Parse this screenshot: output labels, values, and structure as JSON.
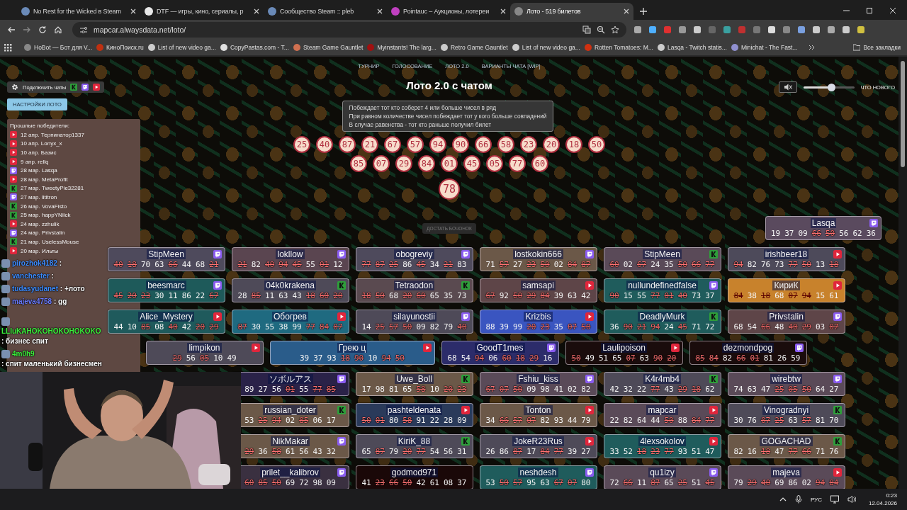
{
  "browser": {
    "tabs": [
      {
        "title": "No Rest for the Wicked в Steam",
        "selected": false
      },
      {
        "title": "DTF — игры, кино, сериалы, р",
        "selected": false
      },
      {
        "title": "Сообщество Steam :: pleb",
        "selected": false
      },
      {
        "title": "Pointauc – Аукционы, лотереи",
        "selected": false
      },
      {
        "title": "Лото - 519 билетов",
        "selected": true
      }
    ],
    "address": "mapcar.alwaysdata.net/loto/",
    "bookmarks": [
      "HoBot — Бот для V...",
      "КиноПоиск.ru",
      "List of new video ga...",
      "CopyPastas.com - T...",
      "Steam Game Gauntlet",
      "Myinstants! The larg...",
      "Retro Game Gauntlet",
      "List of new video ga...",
      "Rotten Tomatoes: M...",
      "Lasqa - Twitch statis...",
      "Minichat - The Fast..."
    ],
    "all_bookmarks": "Все закладки"
  },
  "page": {
    "nav": [
      "ТУРНИР",
      "ГОЛОСОВАНИЕ",
      "ЛОТО 2.0",
      "ВАРИАНТЫ ЧАТА [WIP]"
    ],
    "title": "Лото 2.0 с чатом",
    "rules": [
      "Побеждает тот кто соберет 4 или больше чисел в ряд",
      "При равном количестве чисел побеждает тот у кого больше совпадений",
      "В случае равенства - тот кто раньше получил билет"
    ],
    "connect_chats": "Подключить чаты",
    "settings_button": "НАСТРОЙКИ ЛОТО",
    "sound": {
      "muted": true
    },
    "volume": {
      "level": 0.55
    },
    "whats_new": "ЧТО НОВОГО",
    "drawn_numbers": [
      [
        "25",
        "40",
        "87",
        "21",
        "67",
        "57",
        "94",
        "90",
        "66",
        "58",
        "23",
        "20",
        "18",
        "50"
      ],
      [
        "85",
        "07",
        "29",
        "84",
        "01",
        "45",
        "05",
        "77",
        "60"
      ]
    ],
    "last_number": "78",
    "draw_button": {
      "label": "ДОСТАТЬ БОЧОНОК",
      "disabled": true
    },
    "winners": {
      "title": "Прошлые победители:",
      "items": [
        {
          "text": "12 апр. Терпинатор1337",
          "kind": "youtube"
        },
        {
          "text": "10 апр. Lonyx_x",
          "kind": "youtube"
        },
        {
          "text": "10 апр. Базис",
          "kind": "youtube"
        },
        {
          "text": "9 апр. rellq",
          "kind": "youtube"
        },
        {
          "text": "28 мар. Lasqa",
          "kind": "twitch"
        },
        {
          "text": "28 мар. MetaProfit",
          "kind": "youtube"
        },
        {
          "text": "27 мар. TweetyPie32281",
          "kind": "kick"
        },
        {
          "text": "27 мар. lititron",
          "kind": "twitch"
        },
        {
          "text": "26 мар. VovaFisto",
          "kind": "kick"
        },
        {
          "text": "25 мар. happYNiick",
          "kind": "kick"
        },
        {
          "text": "24 мар. zzhulik",
          "kind": "youtube"
        },
        {
          "text": "24 мар. Privstalin",
          "kind": "twitch"
        },
        {
          "text": "21 мар. UselessMouse",
          "kind": "kick"
        },
        {
          "text": "20 мар. Ильты",
          "kind": "youtube"
        }
      ]
    },
    "ticket_rows": [
      [
        {
          "name": "Lasqa",
          "kind": "twitch",
          "color": "#5a4a5e",
          "nums": [
            "19",
            "37",
            "09",
            "66",
            "50",
            "56",
            "62",
            "36"
          ],
          "hits": [
            false,
            false,
            false,
            true,
            true,
            false,
            false,
            false
          ]
        }
      ],
      [
        {
          "name": "StipMeen",
          "kind": "twitch",
          "color": "#4e4a5c",
          "nums": [
            "40",
            "18",
            "70",
            "63",
            "66",
            "44",
            "68",
            "21"
          ],
          "hits": [
            true,
            true,
            false,
            false,
            true,
            false,
            false,
            true
          ]
        },
        {
          "name": "lokllow",
          "kind": "twitch",
          "color": "#5a4550",
          "nums": [
            "21",
            "82",
            "40",
            "94",
            "45",
            "55",
            "01",
            "12"
          ],
          "hits": [
            true,
            false,
            true,
            true,
            true,
            false,
            true,
            false
          ]
        },
        {
          "name": "obogreviy",
          "kind": "twitch",
          "color": "#4e4a5c",
          "nums": [
            "77",
            "87",
            "25",
            "86",
            "45",
            "34",
            "21",
            "83"
          ],
          "hits": [
            true,
            true,
            true,
            false,
            true,
            false,
            true,
            false
          ]
        },
        {
          "name": "lostkokin666",
          "kind": "twitch",
          "color": "#6b5848",
          "nums": [
            "71",
            "57",
            "27",
            "23",
            "50",
            "02",
            "84",
            "87"
          ],
          "hits": [
            false,
            true,
            false,
            true,
            true,
            false,
            true,
            true
          ]
        },
        {
          "name": "StipMeen",
          "kind": "kick",
          "color": "#5a4a58",
          "nums": [
            "60",
            "02",
            "67",
            "24",
            "35",
            "50",
            "66",
            "77"
          ],
          "hits": [
            true,
            false,
            true,
            false,
            false,
            true,
            true,
            true
          ]
        },
        {
          "name": "irishbeer18",
          "kind": "youtube",
          "color": "#4d4a5a",
          "nums": [
            "94",
            "82",
            "76",
            "73",
            "77",
            "50",
            "13",
            "18"
          ],
          "hits": [
            true,
            false,
            false,
            false,
            true,
            true,
            false,
            true
          ]
        }
      ],
      [
        {
          "name": "beesmarc",
          "kind": "twitch",
          "color": "#1e5a5a",
          "nums": [
            "45",
            "20",
            "23",
            "30",
            "11",
            "86",
            "22",
            "67"
          ],
          "hits": [
            true,
            true,
            true,
            false,
            false,
            false,
            false,
            true
          ]
        },
        {
          "name": "04k0krakena",
          "kind": "kick",
          "color": "#4e4a58",
          "nums": [
            "28",
            "85",
            "11",
            "63",
            "43",
            "18",
            "60",
            "20"
          ],
          "hits": [
            false,
            true,
            false,
            false,
            false,
            true,
            true,
            true
          ]
        },
        {
          "name": "Tetraodon",
          "kind": "kick",
          "color": "#5a4a50",
          "nums": [
            "18",
            "50",
            "68",
            "20",
            "60",
            "65",
            "35",
            "73"
          ],
          "hits": [
            true,
            true,
            false,
            true,
            true,
            false,
            false,
            false
          ]
        },
        {
          "name": "samsapi",
          "kind": "youtube",
          "color": "#5e4548",
          "nums": [
            "67",
            "92",
            "50",
            "29",
            "84",
            "39",
            "63",
            "42"
          ],
          "hits": [
            true,
            false,
            true,
            true,
            true,
            false,
            false,
            false
          ]
        },
        {
          "name": "nullundefinedfalse",
          "kind": "twitch",
          "color": "#1f5c5c",
          "nums": [
            "90",
            "15",
            "55",
            "77",
            "01",
            "40",
            "73",
            "37"
          ],
          "hits": [
            true,
            false,
            false,
            true,
            true,
            true,
            false,
            false
          ]
        },
        {
          "name": "КириК",
          "kind": "youtube",
          "color": "#c8822c",
          "nums": [
            "84",
            "38",
            "18",
            "68",
            "07",
            "94",
            "15",
            "61"
          ],
          "hits": [
            true,
            false,
            true,
            false,
            true,
            true,
            false,
            false
          ]
        }
      ],
      [
        {
          "name": "Alice_Mystery",
          "kind": "youtube",
          "color": "#1f5a5c",
          "nums": [
            "44",
            "10",
            "85",
            "08",
            "40",
            "42",
            "20",
            "29"
          ],
          "hits": [
            false,
            false,
            true,
            false,
            true,
            false,
            true,
            true
          ]
        },
        {
          "name": "Обогрев",
          "kind": "youtube",
          "color": "#1f6a80",
          "nums": [
            "87",
            "30",
            "55",
            "38",
            "99",
            "77",
            "84",
            "07"
          ],
          "hits": [
            true,
            false,
            false,
            false,
            false,
            true,
            true,
            true
          ]
        },
        {
          "name": "silayunostii",
          "kind": "twitch",
          "color": "#4e4a58",
          "nums": [
            "14",
            "25",
            "57",
            "50",
            "09",
            "82",
            "79",
            "40"
          ],
          "hits": [
            false,
            true,
            true,
            true,
            false,
            false,
            false,
            true
          ]
        },
        {
          "name": "Krizbis",
          "kind": "youtube",
          "color": "#3a55c0",
          "nums": [
            "88",
            "39",
            "99",
            "20",
            "23",
            "35",
            "07",
            "50"
          ],
          "hits": [
            false,
            false,
            false,
            true,
            true,
            false,
            true,
            true
          ]
        },
        {
          "name": "DeadlyMurk",
          "kind": "kick",
          "color": "#1f5c5c",
          "nums": [
            "36",
            "90",
            "21",
            "94",
            "24",
            "45",
            "71",
            "72"
          ],
          "hits": [
            false,
            true,
            true,
            true,
            false,
            true,
            false,
            false
          ]
        },
        {
          "name": "Privstalin",
          "kind": "twitch",
          "color": "#5e4548",
          "nums": [
            "68",
            "54",
            "66",
            "48",
            "40",
            "29",
            "03",
            "07"
          ],
          "hits": [
            false,
            false,
            true,
            false,
            true,
            true,
            false,
            true
          ]
        }
      ],
      [
        {
          "name": "limpikon",
          "kind": "youtube",
          "color": "#4e4a58",
          "nums": [
            "29",
            "56",
            "05",
            "10",
            "49"
          ],
          "hits": [
            true,
            false,
            true,
            false,
            false
          ]
        },
        {
          "name": "Грею ц",
          "kind": "youtube",
          "color": "#2a5c8a",
          "nums": [
            "39",
            "37",
            "93",
            "18",
            "90",
            "10",
            "94",
            "50"
          ],
          "hits": [
            false,
            false,
            false,
            true,
            true,
            false,
            true,
            true
          ]
        },
        {
          "name": "GoodT1mes",
          "kind": "twitch",
          "color": "#2c2c6a",
          "nums": [
            "68",
            "54",
            "94",
            "06",
            "60",
            "18",
            "29",
            "16"
          ],
          "hits": [
            false,
            false,
            true,
            false,
            true,
            true,
            true,
            false
          ]
        },
        {
          "name": "Laulipoison",
          "kind": "youtube",
          "color": "#1a0c0c",
          "nums": [
            "50",
            "49",
            "51",
            "65",
            "07",
            "63",
            "90",
            "20"
          ],
          "hits": [
            true,
            false,
            false,
            false,
            true,
            false,
            true,
            true
          ]
        },
        {
          "name": "dezmondpog",
          "kind": "twitch",
          "color": "#1a0c0c",
          "nums": [
            "85",
            "84",
            "82",
            "66",
            "01",
            "81",
            "26",
            "59"
          ],
          "hits": [
            true,
            true,
            false,
            true,
            true,
            false,
            false,
            false
          ]
        }
      ],
      [
        {
          "name": "ソボルアス",
          "kind": "twitch",
          "color": "#2a2248",
          "nums": [
            "89",
            "27",
            "56",
            "01",
            "55",
            "77",
            "85"
          ],
          "hits": [
            false,
            false,
            false,
            true,
            false,
            true,
            true
          ]
        },
        {
          "name": "Uwe_Boll",
          "kind": "kick",
          "color": "#6b5848",
          "nums": [
            "17",
            "98",
            "81",
            "65",
            "58",
            "10",
            "20",
            "23"
          ],
          "hits": [
            false,
            false,
            false,
            false,
            true,
            false,
            true,
            true
          ]
        },
        {
          "name": "Fshiu_kiss",
          "kind": "twitch",
          "color": "#5a4a58",
          "nums": [
            "67",
            "07",
            "50",
            "09",
            "98",
            "41",
            "02",
            "82"
          ],
          "hits": [
            true,
            true,
            true,
            false,
            false,
            false,
            false,
            false
          ]
        },
        {
          "name": "K4r4mb4",
          "kind": "kick",
          "color": "#4e4a58",
          "nums": [
            "42",
            "32",
            "22",
            "77",
            "43",
            "29",
            "18",
            "62"
          ],
          "hits": [
            false,
            false,
            false,
            true,
            false,
            true,
            true,
            false
          ]
        },
        {
          "name": "wirebtw",
          "kind": "twitch",
          "color": "#5a4a58",
          "nums": [
            "74",
            "63",
            "47",
            "25",
            "05",
            "50",
            "64",
            "27"
          ],
          "hits": [
            false,
            false,
            false,
            true,
            true,
            true,
            false,
            false
          ]
        }
      ],
      [
        {
          "name": "russian_doter",
          "kind": "kick",
          "color": "#6b5848",
          "nums": [
            "53",
            "25",
            "94",
            "02",
            "85",
            "06",
            "17"
          ],
          "hits": [
            false,
            true,
            true,
            false,
            true,
            false,
            false
          ]
        },
        {
          "name": "pashteldenata",
          "kind": "youtube",
          "color": "#2a3a5a",
          "nums": [
            "50",
            "01",
            "80",
            "58",
            "91",
            "22",
            "28",
            "09"
          ],
          "hits": [
            true,
            true,
            false,
            true,
            false,
            false,
            false,
            false
          ]
        },
        {
          "name": "Tonton",
          "kind": "youtube",
          "color": "#6b5848",
          "nums": [
            "34",
            "66",
            "57",
            "07",
            "82",
            "93",
            "44",
            "79"
          ],
          "hits": [
            false,
            true,
            true,
            true,
            false,
            false,
            false,
            false
          ]
        },
        {
          "name": "mapcar",
          "kind": "youtube",
          "color": "#5a4a58",
          "nums": [
            "22",
            "82",
            "64",
            "44",
            "50",
            "88",
            "84",
            "77"
          ],
          "hits": [
            false,
            false,
            false,
            false,
            true,
            false,
            true,
            true
          ]
        },
        {
          "name": "Vinogradnyi",
          "kind": "kick",
          "color": "#4e4a58",
          "nums": [
            "30",
            "76",
            "07",
            "25",
            "63",
            "57",
            "81",
            "70"
          ],
          "hits": [
            false,
            false,
            true,
            true,
            false,
            true,
            false,
            false
          ]
        }
      ],
      [
        {
          "name": "NikMakar",
          "kind": "twitch",
          "color": "#6b5848",
          "nums": [
            "29",
            "36",
            "58",
            "61",
            "56",
            "43",
            "32"
          ],
          "hits": [
            true,
            false,
            true,
            false,
            false,
            false,
            false
          ]
        },
        {
          "name": "KiriK_88",
          "kind": "kick",
          "color": "#4e4a58",
          "nums": [
            "65",
            "87",
            "79",
            "20",
            "77",
            "54",
            "56",
            "31"
          ],
          "hits": [
            false,
            true,
            false,
            true,
            true,
            false,
            false,
            false
          ]
        },
        {
          "name": "JokeR23Rus",
          "kind": "youtube",
          "color": "#4e4a58",
          "nums": [
            "26",
            "86",
            "87",
            "17",
            "84",
            "77",
            "39",
            "27"
          ],
          "hits": [
            false,
            false,
            true,
            false,
            true,
            true,
            false,
            false
          ]
        },
        {
          "name": "4lexsokolov",
          "kind": "youtube",
          "color": "#1f5c5c",
          "nums": [
            "33",
            "52",
            "18",
            "23",
            "77",
            "93",
            "51",
            "47"
          ],
          "hits": [
            false,
            false,
            true,
            true,
            true,
            false,
            false,
            false
          ]
        },
        {
          "name": "GOGACHAD",
          "kind": "kick",
          "color": "#6b5848",
          "nums": [
            "82",
            "16",
            "18",
            "47",
            "77",
            "66",
            "71",
            "76"
          ],
          "hits": [
            false,
            false,
            true,
            false,
            true,
            true,
            false,
            false
          ]
        }
      ],
      [
        {
          "name": "prilet__kalibrov",
          "kind": "twitch",
          "color": "#3a3040",
          "nums": [
            "60",
            "85",
            "50",
            "69",
            "72",
            "98",
            "09"
          ],
          "hits": [
            true,
            true,
            true,
            false,
            false,
            false,
            false
          ]
        },
        {
          "name": "godmod971",
          "kind": "none",
          "color": "#1a0808",
          "nums": [
            "41",
            "23",
            "66",
            "50",
            "42",
            "61",
            "08",
            "37"
          ],
          "hits": [
            false,
            true,
            true,
            true,
            false,
            false,
            false,
            false
          ]
        },
        {
          "name": "neshdesh",
          "kind": "twitch",
          "color": "#1f5c5c",
          "nums": [
            "53",
            "50",
            "57",
            "95",
            "63",
            "67",
            "07",
            "80"
          ],
          "hits": [
            false,
            true,
            true,
            false,
            false,
            true,
            true,
            false
          ]
        },
        {
          "name": "qu1izy",
          "kind": "twitch",
          "color": "#5a4a58",
          "nums": [
            "72",
            "66",
            "11",
            "87",
            "65",
            "25",
            "51",
            "45"
          ],
          "hits": [
            false,
            true,
            false,
            true,
            false,
            true,
            false,
            true
          ]
        },
        {
          "name": "majeva",
          "kind": "youtube",
          "color": "#5a4a58",
          "nums": [
            "79",
            "29",
            "40",
            "69",
            "86",
            "02",
            "94",
            "84"
          ],
          "hits": [
            false,
            true,
            true,
            false,
            false,
            false,
            true,
            true
          ]
        }
      ]
    ],
    "chat": [
      {
        "user": "pirozhok4182",
        "text": ":",
        "color": "#3c8cff"
      },
      {
        "user": "vanchester",
        "text": ":",
        "color": "#3c8cff"
      },
      {
        "user": "tudasyudanet",
        "text": ": +лото",
        "color": "#3c8cff"
      },
      {
        "user": "majeva4758",
        "text": ": gg",
        "color": "#6a7cff"
      },
      {
        "user": "LLIuKAHOKOHOKOHOKOKO",
        "text": ": бизнес спит",
        "color": "#3cf03c"
      },
      {
        "user": "4m0h9",
        "text": ": спит маленький бизнесмен",
        "color": "#3cf03c"
      }
    ]
  },
  "taskbar": {
    "language": "РУС",
    "time": "0:23",
    "date": "12.04.2026"
  }
}
